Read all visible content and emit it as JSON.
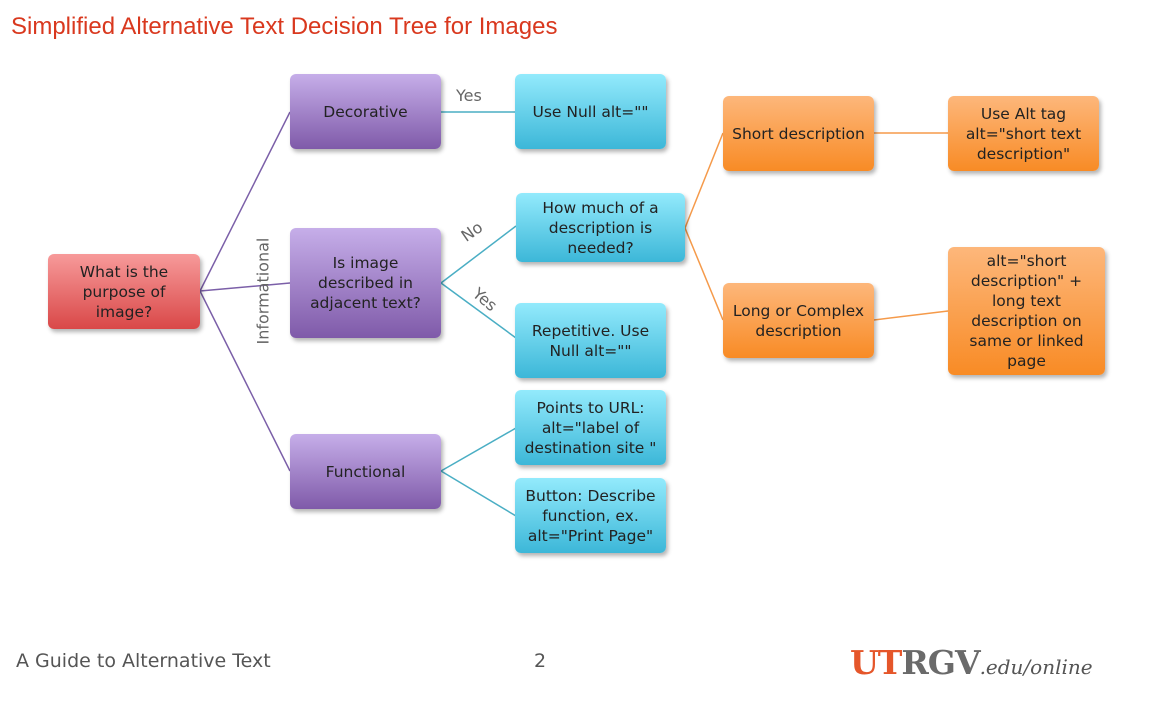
{
  "title": "Simplified Alternative Text Decision Tree for Images",
  "colors": {
    "title": "#d9381e",
    "root": "#e06060",
    "category": "#9a78c7",
    "decision": "#5cc9e6",
    "description": "#fb9f4a",
    "purple_line": "#7b5fa8",
    "teal_line": "#4aaec4",
    "orange_line": "#f59a4a"
  },
  "nodes": {
    "root": "What is the purpose of image?",
    "decorative": "Decorative",
    "adjacent": "Is image described in adjacent text?",
    "functional": "Functional",
    "use_null": "Use Null alt=\"\"",
    "how_much": "How much of a description is needed?",
    "repetitive": "Repetitive. Use Null alt=\"\"",
    "points_url": "Points to URL: alt=\"label of destination site \"",
    "button": "Button: Describe function, ex. alt=\"Print Page\"",
    "short_desc": "Short description",
    "long_desc": "Long or Complex description",
    "use_alt_tag": "Use Alt tag alt=\"short text description\"",
    "long_text": "alt=\"short description\" + long text description on same or linked page"
  },
  "edge_labels": {
    "informational": "Informational",
    "yes_decorative": "Yes",
    "no": "No",
    "yes_adjacent": "Yes"
  },
  "footer": {
    "guide": "A Guide to Alternative Text",
    "page": "2",
    "logo_ut": "UT",
    "logo_rgv": "RGV",
    "logo_suffix": ".edu/online"
  }
}
